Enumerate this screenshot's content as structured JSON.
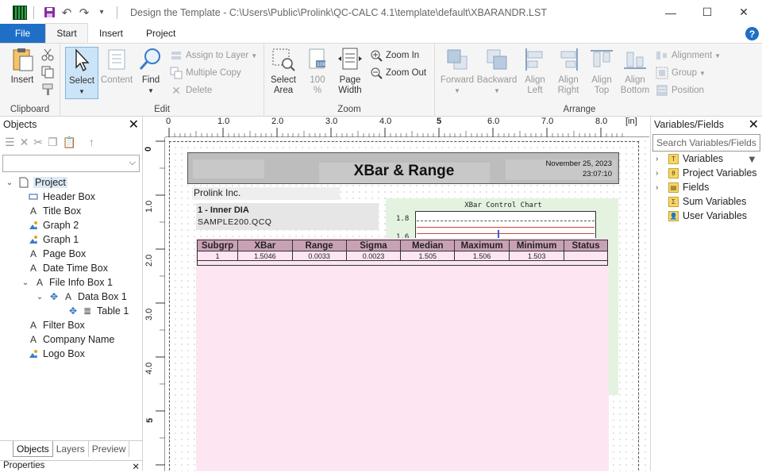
{
  "window": {
    "title": "Design the Template - C:\\Users\\Public\\Prolink\\QC-CALC 4.1\\template\\default\\XBARANDR.LST",
    "minimize": "—",
    "maximize": "☐",
    "close": "✕"
  },
  "tabs": [
    {
      "label": "File"
    },
    {
      "label": "Start"
    },
    {
      "label": "Insert"
    },
    {
      "label": "Project"
    }
  ],
  "help_label": "?",
  "ribbon": {
    "clipboard": {
      "label": "Clipboard",
      "insert": "Insert"
    },
    "edit": {
      "label": "Edit",
      "select": "Select",
      "content": "Content",
      "find": "Find",
      "assign_to_layer": "Assign to Layer",
      "multiple_copy": "Multiple Copy",
      "delete": "Delete"
    },
    "zoom": {
      "label": "Zoom",
      "select_area": "Select Area",
      "pct100": "100 %",
      "page_width": "Page Width",
      "zoom_in": "Zoom In",
      "zoom_out": "Zoom Out"
    },
    "arrange": {
      "label": "Arrange",
      "forward": "Forward",
      "backward": "Backward",
      "align_left": "Align Left",
      "align_right": "Align Right",
      "align_top": "Align Top",
      "align_bottom": "Align Bottom",
      "alignment": "Alignment",
      "group": "Group",
      "position": "Position"
    }
  },
  "objects_panel": {
    "title": "Objects",
    "tree": [
      {
        "label": "Project",
        "icon": "page-icon"
      },
      {
        "label": "Header Box",
        "icon": "rectangle-icon"
      },
      {
        "label": "Title Box",
        "icon": "text-icon"
      },
      {
        "label": "Graph 2",
        "icon": "image-icon"
      },
      {
        "label": "Graph 1",
        "icon": "image-icon"
      },
      {
        "label": "Page Box",
        "icon": "text-icon"
      },
      {
        "label": "Date Time Box",
        "icon": "text-icon"
      },
      {
        "label": "File Info Box 1",
        "icon": "text-icon"
      },
      {
        "label": "Data Box 1",
        "icon": "text-icon"
      },
      {
        "label": "Table 1",
        "icon": "table-icon"
      },
      {
        "label": "Filter Box",
        "icon": "text-icon"
      },
      {
        "label": "Company Name",
        "icon": "text-icon"
      },
      {
        "label": "Logo Box",
        "icon": "image-icon"
      }
    ],
    "bottom_tabs": [
      "Objects",
      "Layers",
      "Preview"
    ],
    "properties_label": "Properties"
  },
  "rulers": {
    "h_ticks": [
      "0",
      "1.0",
      "2.0",
      "3.0",
      "4.0",
      "5",
      "6.0",
      "7.0",
      "8.0"
    ],
    "unit": "[in]",
    "v_ticks": [
      "0",
      "1.0",
      "2.0",
      "3.0",
      "4.0",
      "5"
    ]
  },
  "report": {
    "title": "XBar & Range",
    "date": "November 25, 2023",
    "time": "23:07:10",
    "company": "Prolink Inc.",
    "feature": "1 - Inner DIA",
    "file": "SAMPLE200.QCQ",
    "chart_title": "XBar Control Chart",
    "chart_tick_top": "1.8",
    "chart_tick_second": "1.6",
    "table_headers": [
      "Subgrp",
      "XBar",
      "Range",
      "Sigma",
      "Median",
      "Maximum",
      "Minimum",
      "Status"
    ],
    "table_row": [
      "1",
      "1.5046",
      "0.0033",
      "0.0023",
      "1.505",
      "1.506",
      "1.503",
      ""
    ]
  },
  "variables_panel": {
    "title": "Variables/Fields",
    "search_placeholder": "Search Variables/Fields",
    "items": [
      {
        "label": "Variables",
        "icon": "T"
      },
      {
        "label": "Project Variables",
        "icon": "θ"
      },
      {
        "label": "Fields",
        "icon": "▤"
      },
      {
        "label": "Sum Variables",
        "icon": "Σ"
      },
      {
        "label": "User Variables",
        "icon": "👤"
      }
    ]
  }
}
